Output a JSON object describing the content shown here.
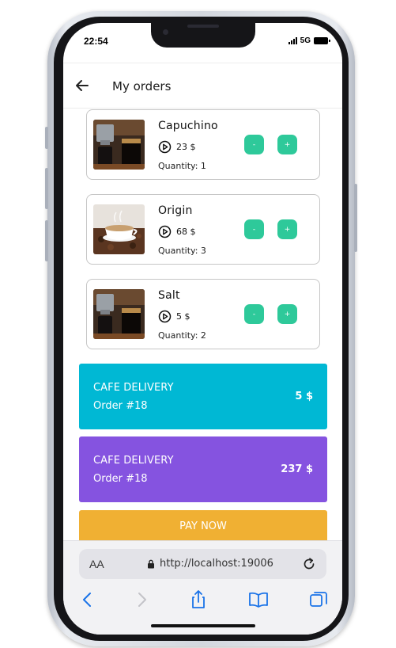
{
  "status_bar": {
    "time": "22:54",
    "network": "5G"
  },
  "header": {
    "title": "My orders"
  },
  "orders": [
    {
      "name": "Capuchino",
      "price": "23 $",
      "quantity": "Quantity: 1",
      "minus_label": "-",
      "plus_label": "+"
    },
    {
      "name": "Origin",
      "price": "68 $",
      "quantity": "Quantity: 3",
      "minus_label": "-",
      "plus_label": "+"
    },
    {
      "name": "Salt",
      "price": "5 $",
      "quantity": "Quantity: 2",
      "minus_label": "-",
      "plus_label": "+"
    }
  ],
  "summaries": [
    {
      "label": "CAFE DELIVERY",
      "order": "Order #18",
      "total": "5 $",
      "color": "#00b8d4"
    },
    {
      "label": "CAFE DELIVERY",
      "order": "Order #18",
      "total": "237 $",
      "color": "#8553e0"
    }
  ],
  "pay_button": {
    "label": "PAY NOW",
    "color": "#f0b033"
  },
  "browser": {
    "aa_label": "AA",
    "url": "http://localhost:19006"
  },
  "colors": {
    "qty_button": "#2ec99a",
    "browser_blue": "#1a73e8"
  }
}
